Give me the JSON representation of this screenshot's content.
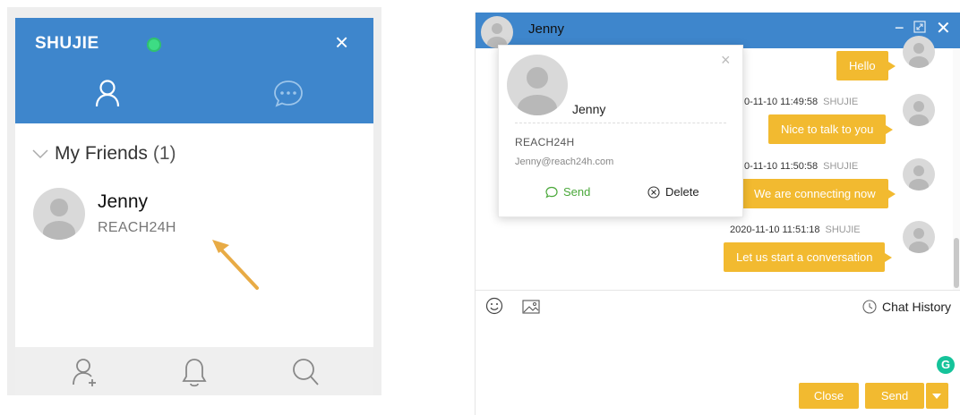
{
  "left_panel": {
    "title": "SHUJIE",
    "close_icon": "×",
    "friends_group_label": "My Friends",
    "friends_count": "(1)",
    "friends": [
      {
        "name": "Jenny",
        "org": "REACH24H"
      }
    ]
  },
  "chat_window": {
    "contact_name": "Jenny",
    "window_controls": {
      "minimize": "−",
      "close": "✕"
    },
    "messages": [
      {
        "timestamp": "",
        "sender": "",
        "text": "Hello"
      },
      {
        "timestamp": "0-11-10 11:49:58",
        "sender": "SHUJIE",
        "text": "Nice to talk to you"
      },
      {
        "timestamp": "0-11-10 11:50:58",
        "sender": "SHUJIE",
        "text": "We are connecting now"
      },
      {
        "timestamp": "2020-11-10 11:51:18",
        "sender": "SHUJIE",
        "text": "Let us start a conversation"
      }
    ],
    "toolbar": {
      "chat_history_label": "Chat History"
    },
    "grammarly_label": "G",
    "close_label": "Close",
    "send_label": "Send"
  },
  "profile_card": {
    "name": "Jenny",
    "org": "REACH24H",
    "email": "Jenny@reach24h.com",
    "send_label": "Send",
    "delete_label": "Delete",
    "close_icon": "×"
  },
  "colors": {
    "header_blue": "#3e86cc",
    "bubble_yellow": "#f2ba30",
    "status_green": "#3ddc84",
    "send_green": "#4aa83a",
    "arrow_orange": "#e8ab45"
  }
}
